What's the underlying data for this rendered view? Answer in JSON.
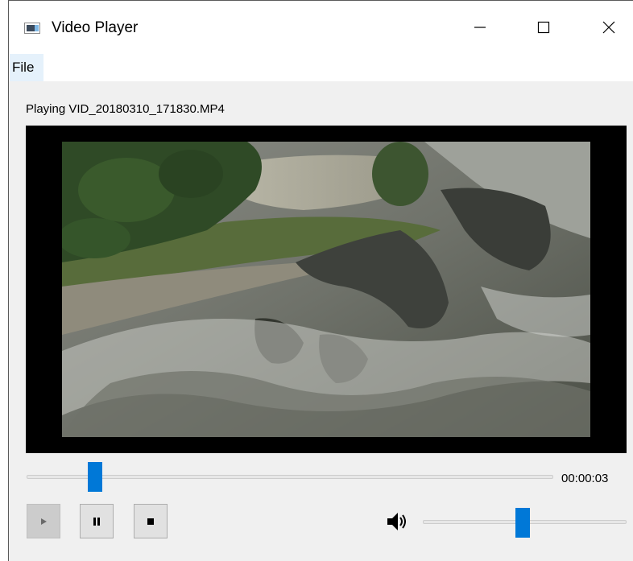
{
  "window": {
    "title": "Video Player",
    "icon": "app-window-icon",
    "controls": [
      "minimize-icon",
      "maximize-icon",
      "close-icon"
    ]
  },
  "menu": {
    "items": [
      {
        "label": "File"
      }
    ]
  },
  "status": "Playing VID_20180310_171830.MP4",
  "player": {
    "position_fraction": 0.12,
    "time": "00:00:03",
    "volume_fraction": 0.49,
    "buttons": {
      "play_icon": "play-icon",
      "pause_icon": "pause-icon",
      "stop_icon": "stop-icon",
      "volume_icon": "speaker-icon"
    }
  },
  "colors": {
    "accent": "#0078d7",
    "video_background": "#000000"
  }
}
